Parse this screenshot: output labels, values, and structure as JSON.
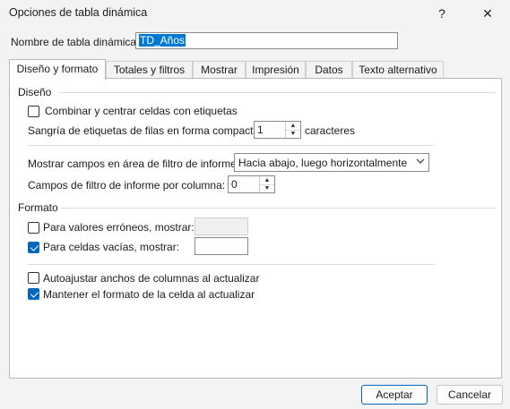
{
  "window": {
    "title": "Opciones de tabla dinámica",
    "help_label": "?",
    "close_label": "✕"
  },
  "name_field": {
    "label": "Nombre de tabla dinámica:",
    "value": "TD_Años"
  },
  "tabs": [
    {
      "label": "Diseño y formato"
    },
    {
      "label": "Totales y filtros"
    },
    {
      "label": "Mostrar"
    },
    {
      "label": "Impresión"
    },
    {
      "label": "Datos"
    },
    {
      "label": "Texto alternativo"
    }
  ],
  "diseno": {
    "heading": "Diseño",
    "merge_label": "Combinar y centrar celdas con etiquetas",
    "merge_checked": false,
    "indent_label": "Sangría de etiquetas de filas en forma compacta:",
    "indent_value": "1",
    "indent_unit": "caracteres",
    "filter_area_label": "Mostrar campos en área de filtro de informe:",
    "filter_area_value": "Hacia abajo, luego horizontalmente",
    "filter_cols_label": "Campos de filtro de informe por columna:",
    "filter_cols_value": "0"
  },
  "formato": {
    "heading": "Formato",
    "error_label": "Para valores erróneos, mostrar:",
    "error_checked": false,
    "error_value": "",
    "empty_label": "Para celdas vacías, mostrar:",
    "empty_checked": true,
    "empty_value": "",
    "autofit_label": "Autoajustar anchos de columnas al actualizar",
    "autofit_checked": false,
    "keep_format_label": "Mantener el formato de la celda al actualizar",
    "keep_format_checked": true
  },
  "buttons": {
    "ok": "Aceptar",
    "cancel": "Cancelar"
  },
  "colors": {
    "accent": "#0067c0",
    "dialog_bg": "#f3f3f3",
    "panel_bg": "#ffffff"
  }
}
